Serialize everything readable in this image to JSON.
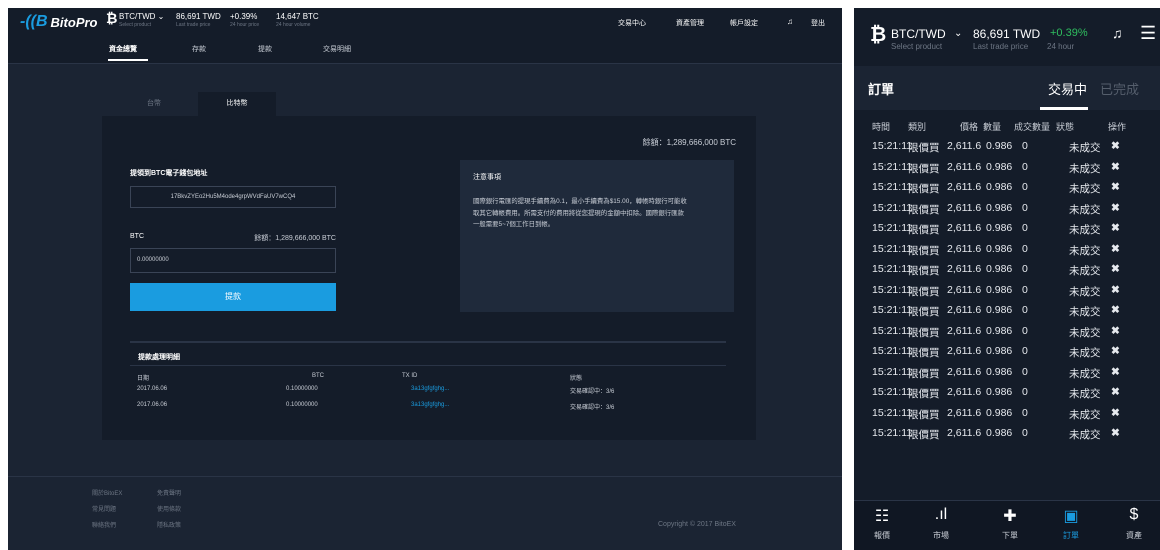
{
  "desktop": {
    "brand": "BitoPro",
    "ticker": {
      "pair": "BTC/TWD",
      "pair_sub": "Select product",
      "price": "86,691 TWD",
      "price_sub": "Last trade price",
      "change": "+0.39%",
      "change_sub": "24 hour price",
      "volume": "14,647 BTC",
      "volume_sub": "24 hour volume"
    },
    "topnav": [
      "交易中心",
      "資產管理",
      "帳戶設定",
      "登出"
    ],
    "subnav": [
      "資金總覽",
      "存款",
      "提款",
      "交易明細"
    ],
    "currency_tabs": [
      "台幣",
      "比特幣"
    ],
    "balance_top": "餘額：1,289,666,000 BTC",
    "address_label": "提領到BTC電子錢包地址",
    "address_value": "17BkvZYEo2Hu5M4ode4grpWVdFaUV7wCQ4",
    "btc_label": "BTC",
    "btc_balance": "餘額：1,289,666,000 BTC",
    "amount_value": "0.00000000",
    "withdraw_button": "提款",
    "notice_title": "注意事項",
    "notice_body": "國際銀行電匯的提現手續費為0.1，最小手續費為$15.00，轉帳時銀行可能收取其它轉帳費用。所需支付的費用將從您提現的金額中扣除。國際銀行匯款一般需要5~7個工作日到帳。",
    "table_title": "提款處理明細",
    "table_headers": [
      "日期",
      "BTC",
      "TX ID",
      "狀態"
    ],
    "table_rows": [
      [
        "2017.06.06",
        "0.10000000",
        "3a13gfgfghg...",
        "交易確認中：3/6"
      ],
      [
        "2017.06.06",
        "0.10000000",
        "3a13gfgfghg...",
        "交易確認中：3/6"
      ]
    ],
    "footer_col1": [
      "關於BitoEX",
      "常見問題",
      "聯絡我們"
    ],
    "footer_col2": [
      "免責聲明",
      "使用條款",
      "隱私政策"
    ],
    "copyright": "Copyright © 2017 BitoEX"
  },
  "mobile": {
    "pair": "BTC/TWD",
    "pair_sub": "Select product",
    "price": "86,691 TWD",
    "price_sub": "Last trade price",
    "change": "+0.39%",
    "change_sub": "24 hour",
    "title": "訂單",
    "tab_active": "交易中",
    "tab_done": "已完成",
    "headers": [
      "時間",
      "類別",
      "價格",
      "數量",
      "成交數量",
      "狀態",
      "操作"
    ],
    "rows": [
      [
        "15:21:11",
        "限價買",
        "2,611.6",
        "0.986",
        "0",
        "未成交"
      ],
      [
        "15:21:11",
        "限價買",
        "2,611.6",
        "0.986",
        "0",
        "未成交"
      ],
      [
        "15:21:11",
        "限價買",
        "2,611.6",
        "0.986",
        "0",
        "未成交"
      ],
      [
        "15:21:11",
        "限價買",
        "2,611.6",
        "0.986",
        "0",
        "未成交"
      ],
      [
        "15:21:11",
        "限價買",
        "2,611.6",
        "0.986",
        "0",
        "未成交"
      ],
      [
        "15:21:11",
        "限價買",
        "2,611.6",
        "0.986",
        "0",
        "未成交"
      ],
      [
        "15:21:11",
        "限價買",
        "2,611.6",
        "0.986",
        "0",
        "未成交"
      ],
      [
        "15:21:11",
        "限價買",
        "2,611.6",
        "0.986",
        "0",
        "未成交"
      ],
      [
        "15:21:11",
        "限價買",
        "2,611.6",
        "0.986",
        "0",
        "未成交"
      ],
      [
        "15:21:11",
        "限價買",
        "2,611.6",
        "0.986",
        "0",
        "未成交"
      ],
      [
        "15:21:11",
        "限價買",
        "2,611.6",
        "0.986",
        "0",
        "未成交"
      ],
      [
        "15:21:11",
        "限價買",
        "2,611.6",
        "0.986",
        "0",
        "未成交"
      ],
      [
        "15:21:11",
        "限價買",
        "2,611.6",
        "0.986",
        "0",
        "未成交"
      ],
      [
        "15:21:11",
        "限價買",
        "2,611.6",
        "0.986",
        "0",
        "未成交"
      ],
      [
        "15:21:11",
        "限價買",
        "2,611.6",
        "0.986",
        "0",
        "未成交"
      ]
    ],
    "bottom_nav": [
      {
        "label": "報價",
        "icon": "list-icon"
      },
      {
        "label": "市場",
        "icon": "bar-signal-icon"
      },
      {
        "label": "下單",
        "icon": "plus-icon"
      },
      {
        "label": "訂單",
        "icon": "inbox-icon",
        "active": true
      },
      {
        "label": "資產",
        "icon": "dollar-icon"
      }
    ]
  },
  "colors": {
    "accent": "#1a9ce0",
    "up": "#2fbf5f",
    "bg_dark": "#141c29",
    "bg_page": "#1b2433"
  }
}
